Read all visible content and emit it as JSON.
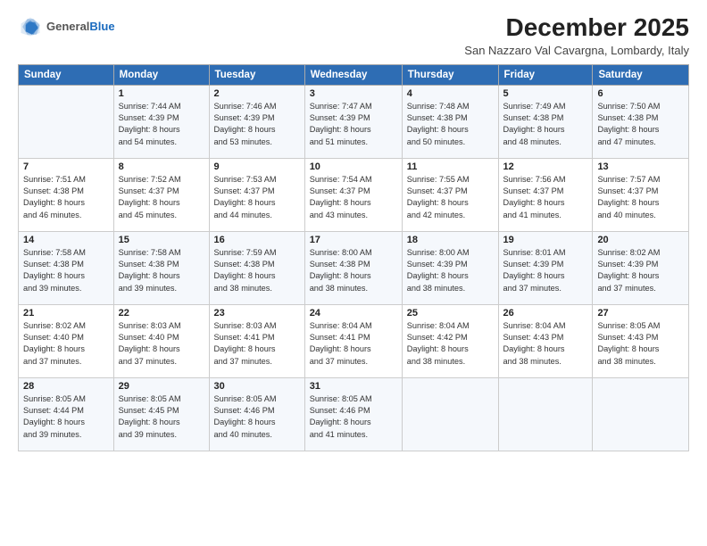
{
  "logo": {
    "general": "General",
    "blue": "Blue"
  },
  "header": {
    "title": "December 2025",
    "subtitle": "San Nazzaro Val Cavargna, Lombardy, Italy"
  },
  "weekdays": [
    "Sunday",
    "Monday",
    "Tuesday",
    "Wednesday",
    "Thursday",
    "Friday",
    "Saturday"
  ],
  "weeks": [
    [
      {
        "day": "",
        "sunrise": "",
        "sunset": "",
        "daylight": ""
      },
      {
        "day": "1",
        "sunrise": "Sunrise: 7:44 AM",
        "sunset": "Sunset: 4:39 PM",
        "daylight": "Daylight: 8 hours and 54 minutes."
      },
      {
        "day": "2",
        "sunrise": "Sunrise: 7:46 AM",
        "sunset": "Sunset: 4:39 PM",
        "daylight": "Daylight: 8 hours and 53 minutes."
      },
      {
        "day": "3",
        "sunrise": "Sunrise: 7:47 AM",
        "sunset": "Sunset: 4:39 PM",
        "daylight": "Daylight: 8 hours and 51 minutes."
      },
      {
        "day": "4",
        "sunrise": "Sunrise: 7:48 AM",
        "sunset": "Sunset: 4:38 PM",
        "daylight": "Daylight: 8 hours and 50 minutes."
      },
      {
        "day": "5",
        "sunrise": "Sunrise: 7:49 AM",
        "sunset": "Sunset: 4:38 PM",
        "daylight": "Daylight: 8 hours and 48 minutes."
      },
      {
        "day": "6",
        "sunrise": "Sunrise: 7:50 AM",
        "sunset": "Sunset: 4:38 PM",
        "daylight": "Daylight: 8 hours and 47 minutes."
      }
    ],
    [
      {
        "day": "7",
        "sunrise": "Sunrise: 7:51 AM",
        "sunset": "Sunset: 4:38 PM",
        "daylight": "Daylight: 8 hours and 46 minutes."
      },
      {
        "day": "8",
        "sunrise": "Sunrise: 7:52 AM",
        "sunset": "Sunset: 4:37 PM",
        "daylight": "Daylight: 8 hours and 45 minutes."
      },
      {
        "day": "9",
        "sunrise": "Sunrise: 7:53 AM",
        "sunset": "Sunset: 4:37 PM",
        "daylight": "Daylight: 8 hours and 44 minutes."
      },
      {
        "day": "10",
        "sunrise": "Sunrise: 7:54 AM",
        "sunset": "Sunset: 4:37 PM",
        "daylight": "Daylight: 8 hours and 43 minutes."
      },
      {
        "day": "11",
        "sunrise": "Sunrise: 7:55 AM",
        "sunset": "Sunset: 4:37 PM",
        "daylight": "Daylight: 8 hours and 42 minutes."
      },
      {
        "day": "12",
        "sunrise": "Sunrise: 7:56 AM",
        "sunset": "Sunset: 4:37 PM",
        "daylight": "Daylight: 8 hours and 41 minutes."
      },
      {
        "day": "13",
        "sunrise": "Sunrise: 7:57 AM",
        "sunset": "Sunset: 4:37 PM",
        "daylight": "Daylight: 8 hours and 40 minutes."
      }
    ],
    [
      {
        "day": "14",
        "sunrise": "Sunrise: 7:58 AM",
        "sunset": "Sunset: 4:38 PM",
        "daylight": "Daylight: 8 hours and 39 minutes."
      },
      {
        "day": "15",
        "sunrise": "Sunrise: 7:58 AM",
        "sunset": "Sunset: 4:38 PM",
        "daylight": "Daylight: 8 hours and 39 minutes."
      },
      {
        "day": "16",
        "sunrise": "Sunrise: 7:59 AM",
        "sunset": "Sunset: 4:38 PM",
        "daylight": "Daylight: 8 hours and 38 minutes."
      },
      {
        "day": "17",
        "sunrise": "Sunrise: 8:00 AM",
        "sunset": "Sunset: 4:38 PM",
        "daylight": "Daylight: 8 hours and 38 minutes."
      },
      {
        "day": "18",
        "sunrise": "Sunrise: 8:00 AM",
        "sunset": "Sunset: 4:39 PM",
        "daylight": "Daylight: 8 hours and 38 minutes."
      },
      {
        "day": "19",
        "sunrise": "Sunrise: 8:01 AM",
        "sunset": "Sunset: 4:39 PM",
        "daylight": "Daylight: 8 hours and 37 minutes."
      },
      {
        "day": "20",
        "sunrise": "Sunrise: 8:02 AM",
        "sunset": "Sunset: 4:39 PM",
        "daylight": "Daylight: 8 hours and 37 minutes."
      }
    ],
    [
      {
        "day": "21",
        "sunrise": "Sunrise: 8:02 AM",
        "sunset": "Sunset: 4:40 PM",
        "daylight": "Daylight: 8 hours and 37 minutes."
      },
      {
        "day": "22",
        "sunrise": "Sunrise: 8:03 AM",
        "sunset": "Sunset: 4:40 PM",
        "daylight": "Daylight: 8 hours and 37 minutes."
      },
      {
        "day": "23",
        "sunrise": "Sunrise: 8:03 AM",
        "sunset": "Sunset: 4:41 PM",
        "daylight": "Daylight: 8 hours and 37 minutes."
      },
      {
        "day": "24",
        "sunrise": "Sunrise: 8:04 AM",
        "sunset": "Sunset: 4:41 PM",
        "daylight": "Daylight: 8 hours and 37 minutes."
      },
      {
        "day": "25",
        "sunrise": "Sunrise: 8:04 AM",
        "sunset": "Sunset: 4:42 PM",
        "daylight": "Daylight: 8 hours and 38 minutes."
      },
      {
        "day": "26",
        "sunrise": "Sunrise: 8:04 AM",
        "sunset": "Sunset: 4:43 PM",
        "daylight": "Daylight: 8 hours and 38 minutes."
      },
      {
        "day": "27",
        "sunrise": "Sunrise: 8:05 AM",
        "sunset": "Sunset: 4:43 PM",
        "daylight": "Daylight: 8 hours and 38 minutes."
      }
    ],
    [
      {
        "day": "28",
        "sunrise": "Sunrise: 8:05 AM",
        "sunset": "Sunset: 4:44 PM",
        "daylight": "Daylight: 8 hours and 39 minutes."
      },
      {
        "day": "29",
        "sunrise": "Sunrise: 8:05 AM",
        "sunset": "Sunset: 4:45 PM",
        "daylight": "Daylight: 8 hours and 39 minutes."
      },
      {
        "day": "30",
        "sunrise": "Sunrise: 8:05 AM",
        "sunset": "Sunset: 4:46 PM",
        "daylight": "Daylight: 8 hours and 40 minutes."
      },
      {
        "day": "31",
        "sunrise": "Sunrise: 8:05 AM",
        "sunset": "Sunset: 4:46 PM",
        "daylight": "Daylight: 8 hours and 41 minutes."
      },
      {
        "day": "",
        "sunrise": "",
        "sunset": "",
        "daylight": ""
      },
      {
        "day": "",
        "sunrise": "",
        "sunset": "",
        "daylight": ""
      },
      {
        "day": "",
        "sunrise": "",
        "sunset": "",
        "daylight": ""
      }
    ]
  ]
}
